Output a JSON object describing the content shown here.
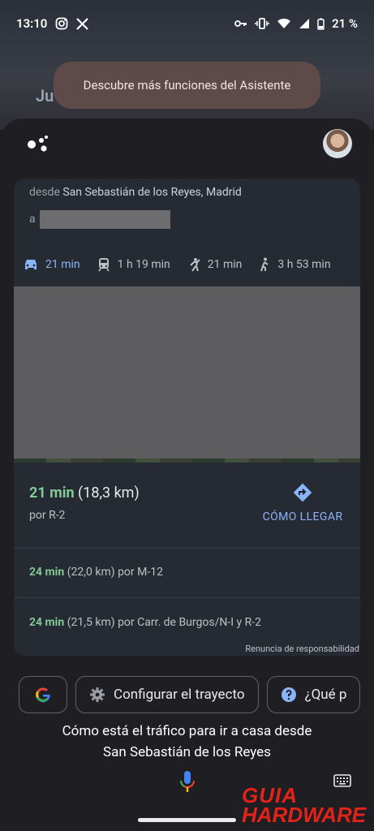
{
  "status": {
    "time": "13:10",
    "battery": "21 %"
  },
  "background": {
    "text": "Ju"
  },
  "toast": {
    "label": "Descubre más funciones del Asistente"
  },
  "route": {
    "from_label": "desde",
    "from_place": "San Sebastián de los Reyes, Madrid",
    "to_label": "a"
  },
  "modes": [
    {
      "icon": "car-icon",
      "time": "21 min"
    },
    {
      "icon": "train-icon",
      "time": "1 h 19 min"
    },
    {
      "icon": "rideshare-icon",
      "time": "21 min"
    },
    {
      "icon": "walk-icon",
      "time": "3 h 53 min"
    }
  ],
  "best": {
    "time": "21 min",
    "distance": "(18,3 km)",
    "via": "por R-2",
    "directions_label": "CÓMO LLEGAR"
  },
  "alternatives": [
    {
      "time": "24 min",
      "detail": "(22,0 km) por M-12"
    },
    {
      "time": "24 min",
      "detail": "(21,5 km) por Carr. de Burgos/N-I y R-2"
    }
  ],
  "disclaimer": "Renuncia de responsabilidad",
  "chips": {
    "configure": "Configurar el trayecto",
    "what": "¿Qué p"
  },
  "query": {
    "line1": "Cómo está el tráfico para ir a casa desde",
    "line2": "San Sebastián de los Reyes"
  },
  "watermark": {
    "line1": "GUIA",
    "line2": "HARDWARE"
  },
  "colors": {
    "accent": "#8ab4f8",
    "green": "#81c995",
    "toast": "#5e4a49",
    "watermark": "#e2231a"
  }
}
